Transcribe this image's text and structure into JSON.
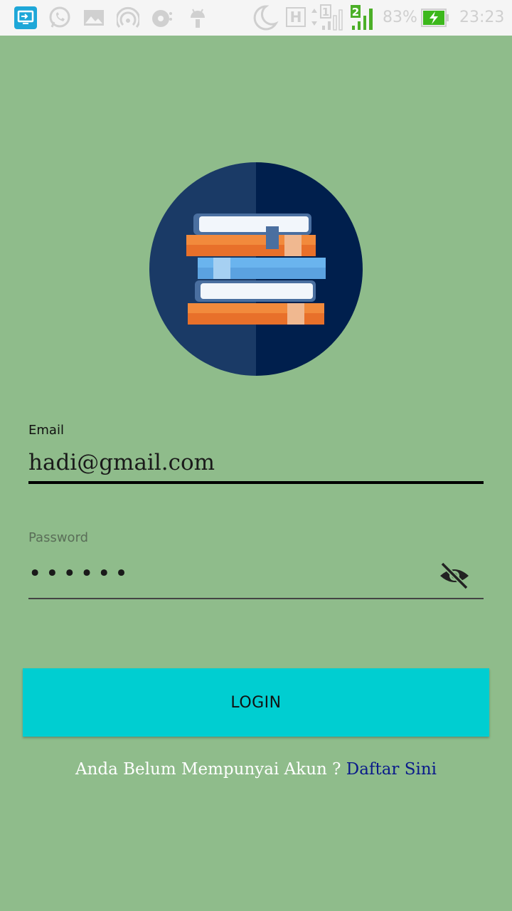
{
  "status_bar": {
    "icons": [
      "screen-mirror-icon",
      "whatsapp-icon",
      "image-icon",
      "hotspot-icon",
      "settings-sync-icon",
      "android-icon",
      "moon-icon",
      "h-network-icon",
      "sim1-signal-icon",
      "sim2-signal-icon",
      "battery-charging-icon"
    ],
    "sim1_label": "1",
    "sim2_label": "2",
    "network_label": "H",
    "battery_percent": "83%",
    "time": "23:23"
  },
  "logo": {
    "icon": "books-stack-icon"
  },
  "form": {
    "email": {
      "label": "Email",
      "value": "hadi@gmail.com"
    },
    "password": {
      "label": "Password",
      "value": "••••••",
      "toggle_icon": "eye-off-icon"
    },
    "login_label": "LOGIN"
  },
  "footer": {
    "question": "Anda Belum Mempunyai Akun ?",
    "link": "Daftar Sini"
  },
  "colors": {
    "background": "#8fbc8b",
    "button": "#00ced1",
    "logo_circle_dark": "#001f4d",
    "logo_circle_light": "#1a3a66",
    "link": "#0a1a8a"
  }
}
